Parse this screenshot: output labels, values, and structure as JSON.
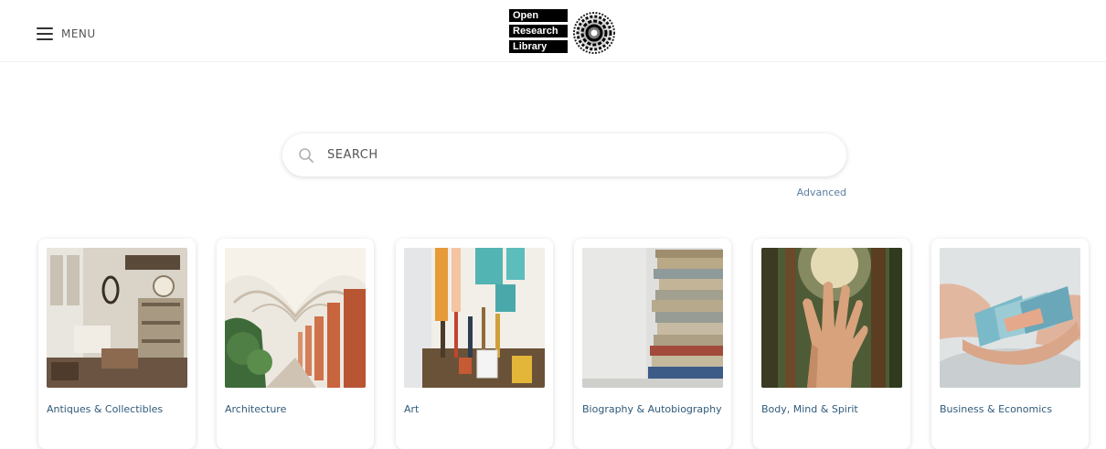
{
  "header": {
    "menu_label": "MENU",
    "logo": {
      "words": [
        "Open",
        "Research",
        "Library"
      ]
    }
  },
  "search": {
    "placeholder": "SEARCH",
    "advanced_label": "Advanced"
  },
  "categories": [
    {
      "label": "Antiques & Collectibles",
      "icon": "antiques-photo"
    },
    {
      "label": "Architecture",
      "icon": "architecture-photo"
    },
    {
      "label": "Art",
      "icon": "art-photo"
    },
    {
      "label": "Biography & Autobiography",
      "icon": "books-photo"
    },
    {
      "label": "Body, Mind & Spirit",
      "icon": "hand-photo"
    },
    {
      "label": "Business & Economics",
      "icon": "money-photo"
    }
  ]
}
